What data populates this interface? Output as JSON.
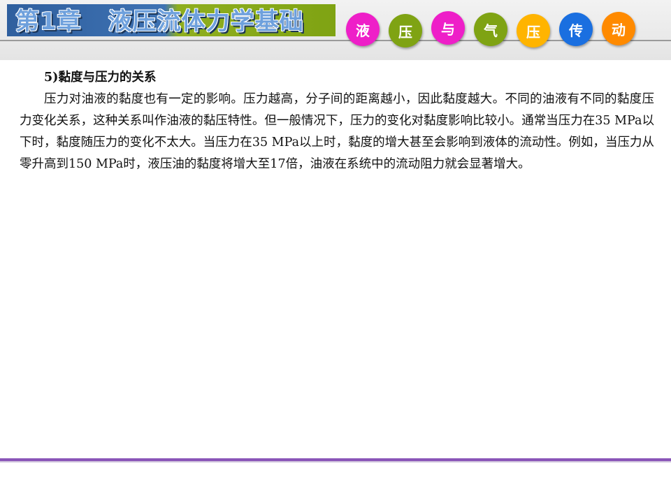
{
  "header": {
    "chapter": "第1章",
    "title": "液压流体力学基础",
    "badges": [
      {
        "char": "液",
        "color": "#ee1fc8"
      },
      {
        "char": "压",
        "color": "#7fa313"
      },
      {
        "char": "与",
        "color": "#ee1fc8"
      },
      {
        "char": "气",
        "color": "#7fa313"
      },
      {
        "char": "压",
        "color": "#ffb400"
      },
      {
        "char": "传",
        "color": "#1a6fe0"
      },
      {
        "char": "动",
        "color": "#ff8a00"
      }
    ]
  },
  "section": {
    "heading": "5)黏度与压力的关系",
    "body": "压力对油液的黏度也有一定的影响。压力越高，分子间的距离越小，因此黏度越大。不同的油液有不同的黏度压力变化关系，这种关系叫作油液的黏压特性。但一般情况下，压力的变化对黏度影响比较小。通常当压力在35 MPa以下时，黏度随压力的变化不太大。当压力在35 MPa以上时，黏度的增大甚至会影响到液体的流动性。例如，当压力从零升高到150 MPa时，液压油的黏度将增大至17倍，油液在系统中的流动阻力就会显著增大。"
  }
}
